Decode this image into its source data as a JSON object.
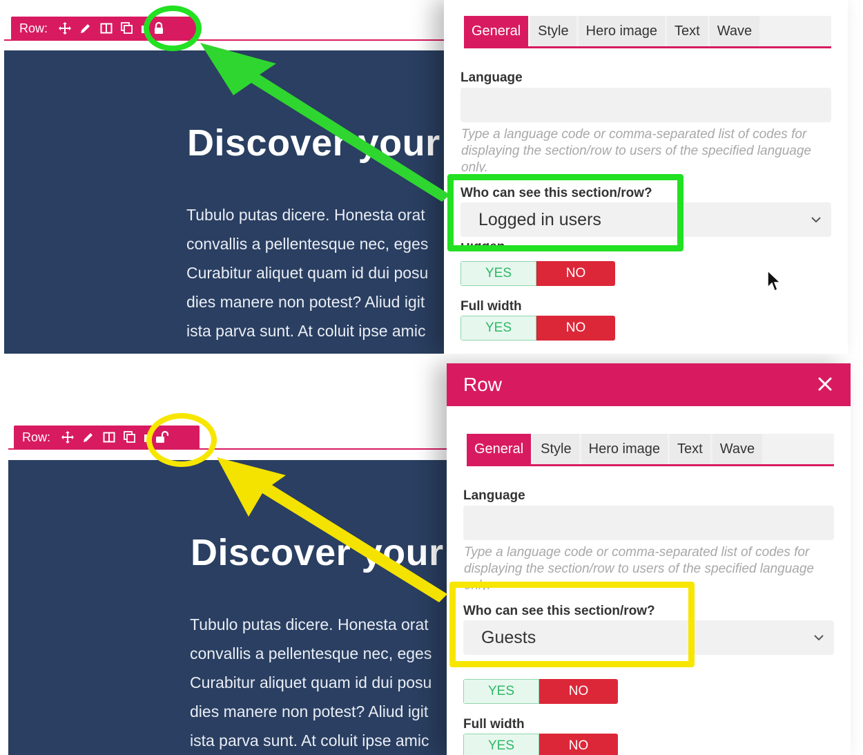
{
  "colors": {
    "accent": "#d81b60",
    "hero_bg": "#2a3f61",
    "highlight_green": "#22e022",
    "highlight_yellow": "#f7e600",
    "toggle_no": "#dc2739",
    "toggle_yes_text": "#2eb865"
  },
  "panels": [
    {
      "toolbar": {
        "label": "Row:",
        "icons": [
          "move-icon",
          "pencil-icon",
          "columns-icon",
          "duplicate-icon",
          "delete-icon",
          "lock-closed-icon"
        ]
      },
      "hero": {
        "title": "Discover your f",
        "lines": [
          "Tubulo putas dicere. Honesta orat",
          "convallis a pellentesque nec, eges",
          "Curabitur aliquet quam id dui posu",
          "dies manere non potest? Aliud igit",
          "ista parva sunt. At coluit ipse amic"
        ]
      },
      "modal": {
        "title": "",
        "tabs": [
          "General",
          "Style",
          "Hero image",
          "Text",
          "Wave"
        ],
        "active_tab": "General",
        "language_label": "Language",
        "language_value": "",
        "language_help": "Type a language code or comma-separated list of codes for displaying the section/row to users of the specified language only.",
        "visibility_label": "Who can see this section/row?",
        "visibility_value": "Logged in users",
        "hidden_label": "Hidden",
        "full_width_label": "Full width",
        "yes_label": "YES",
        "no_label": "NO"
      },
      "highlight_color_name": "green"
    },
    {
      "toolbar": {
        "label": "Row:",
        "icons": [
          "move-icon",
          "pencil-icon",
          "columns-icon",
          "duplicate-icon",
          "delete-icon",
          "lock-open-icon"
        ]
      },
      "hero": {
        "title": "Discover your f",
        "lines": [
          "Tubulo putas dicere. Honesta orat",
          "convallis a pellentesque nec, eges",
          "Curabitur aliquet quam id dui posu",
          "dies manere non potest? Aliud igit",
          "ista parva sunt. At coluit ipse amic"
        ]
      },
      "modal": {
        "title": "Row",
        "tabs": [
          "General",
          "Style",
          "Hero image",
          "Text",
          "Wave"
        ],
        "active_tab": "General",
        "language_label": "Language",
        "language_value": "",
        "language_help": "Type a language code or comma-separated list of codes for displaying the section/row to users of the specified language only.",
        "visibility_label": "Who can see this section/row?",
        "visibility_value": "Guests",
        "full_width_label": "Full width",
        "yes_label": "YES",
        "no_label": "NO"
      },
      "highlight_color_name": "yellow"
    }
  ]
}
